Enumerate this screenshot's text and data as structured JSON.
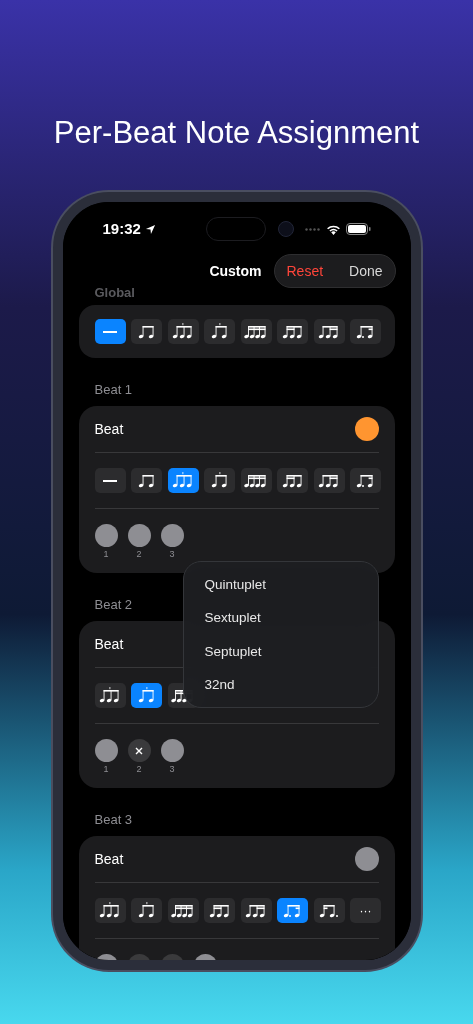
{
  "title": "Per-Beat Note Assignment",
  "status_bar": {
    "time": "19:32"
  },
  "nav": {
    "title": "Custom",
    "reset": "Reset",
    "done": "Done"
  },
  "global": {
    "label": "Global",
    "notes": [
      {
        "kind": "rest",
        "selected": true
      },
      {
        "kind": "eighths",
        "selected": false
      },
      {
        "kind": "triplet",
        "selected": false
      },
      {
        "kind": "tripletpair",
        "selected": false
      },
      {
        "kind": "sixteenths",
        "selected": false
      },
      {
        "kind": "leadsixteenths",
        "selected": false
      },
      {
        "kind": "tailsixteenths",
        "selected": false
      },
      {
        "kind": "dotted",
        "selected": false
      }
    ]
  },
  "beats": [
    {
      "label": "Beat 1",
      "row_label": "Beat",
      "color": "#ff9530",
      "notes": [
        {
          "kind": "rest",
          "selected": false
        },
        {
          "kind": "eighths",
          "selected": false
        },
        {
          "kind": "triplet",
          "selected": true
        },
        {
          "kind": "tripletpair",
          "selected": false
        },
        {
          "kind": "sixteenths",
          "selected": false
        },
        {
          "kind": "leadsixteenths",
          "selected": false
        },
        {
          "kind": "tailsixteenths",
          "selected": false
        },
        {
          "kind": "dotted",
          "selected": false
        }
      ],
      "dots": [
        {
          "label": "1",
          "muted": false
        },
        {
          "label": "2",
          "muted": false
        },
        {
          "label": "3",
          "muted": false
        }
      ]
    },
    {
      "label": "Beat 2",
      "row_label": "Beat",
      "notes": [
        {
          "kind": "triplet",
          "selected": false
        },
        {
          "kind": "tripletpair",
          "selected": true
        },
        {
          "kind": "sixteenths",
          "selected": false
        }
      ],
      "dots": [
        {
          "label": "1",
          "muted": false
        },
        {
          "label": "2",
          "muted": true
        },
        {
          "label": "3",
          "muted": false
        }
      ]
    },
    {
      "label": "Beat 3",
      "row_label": "Beat",
      "color": "#8e8e93",
      "notes": [
        {
          "kind": "triplet",
          "selected": false
        },
        {
          "kind": "tripletpair",
          "selected": false
        },
        {
          "kind": "sixteenths",
          "selected": false
        },
        {
          "kind": "leadsixteenths",
          "selected": false
        },
        {
          "kind": "tailsixteenths",
          "selected": false
        },
        {
          "kind": "dotted",
          "selected": true
        },
        {
          "kind": "reversedotted",
          "selected": false
        },
        {
          "kind": "more",
          "label": "···",
          "selected": false
        }
      ],
      "dots": [
        {
          "muted": false
        },
        {
          "muted": true
        },
        {
          "muted": true
        },
        {
          "muted": false
        }
      ]
    }
  ],
  "menu": {
    "items": [
      "Quintuplet",
      "Sextuplet",
      "Septuplet",
      "32nd"
    ]
  }
}
